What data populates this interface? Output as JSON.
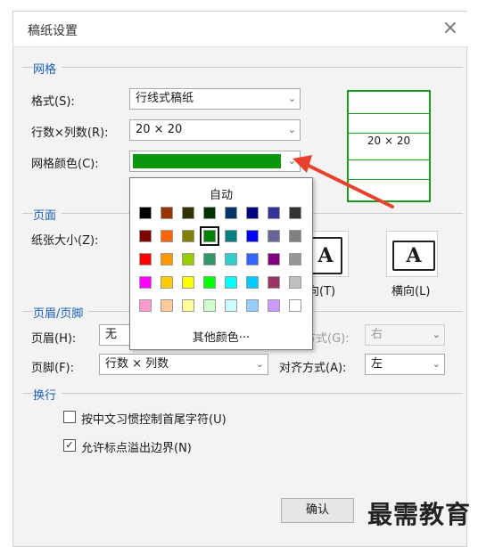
{
  "dialog": {
    "title": "稿纸设置",
    "close_icon": "×"
  },
  "grid_section": {
    "heading": "网格",
    "style_label": "格式(S):",
    "style_value": "行线式稿纸",
    "rows_cols_label": "行数×列数(R):",
    "rows_cols_value": "20 × 20",
    "color_label": "网格颜色(C):",
    "color_value": "#0a960a"
  },
  "preview": {
    "text": "20 × 20"
  },
  "page_section": {
    "heading": "页面",
    "paper_size_label": "纸张大小(Z):",
    "portrait_label": "向(T)",
    "landscape_label": "横向(L)",
    "icon_letter": "A"
  },
  "header_footer_section": {
    "heading": "页眉/页脚",
    "header_label": "页眉(H):",
    "header_value": "无",
    "header_align_label": "方式(G):",
    "header_align_value": "右",
    "footer_label": "页脚(F):",
    "footer_value": "行数 × 列数",
    "footer_align_label": "对齐方式(A):",
    "footer_align_value": "左"
  },
  "wrap_section": {
    "heading": "换行",
    "option1_label": "按中文习惯控制首尾字符(U)",
    "option1_checked": false,
    "option2_label": "允许标点溢出边界(N)",
    "option2_checked": true
  },
  "buttons": {
    "ok_label": "确认"
  },
  "palette": {
    "auto_label": "自动",
    "more_colors_label": "其他颜色···",
    "colors": [
      [
        "#000000",
        "#993300",
        "#333300",
        "#003300",
        "#003366",
        "#000080",
        "#333399",
        "#333333"
      ],
      [
        "#800000",
        "#ff6600",
        "#808000",
        "#008000",
        "#008080",
        "#0000ff",
        "#666699",
        "#808080"
      ],
      [
        "#ff0000",
        "#ff9900",
        "#99cc00",
        "#339966",
        "#33cccc",
        "#3366ff",
        "#800080",
        "#969696"
      ],
      [
        "#ff00ff",
        "#ffcc00",
        "#ffff00",
        "#00ff00",
        "#00ffff",
        "#00ccff",
        "#993366",
        "#c0c0c0"
      ],
      [
        "#ff99cc",
        "#ffcc99",
        "#ffff99",
        "#ccffcc",
        "#ccffff",
        "#99ccff",
        "#cc99ff",
        "#ffffff"
      ]
    ],
    "selected": [
      1,
      3
    ]
  },
  "watermark": {
    "text": "最需教育"
  },
  "annotation": {
    "arrow_color": "#e8412c"
  },
  "icons": {
    "dropdown": "chevron-down-icon",
    "check": "✓"
  }
}
